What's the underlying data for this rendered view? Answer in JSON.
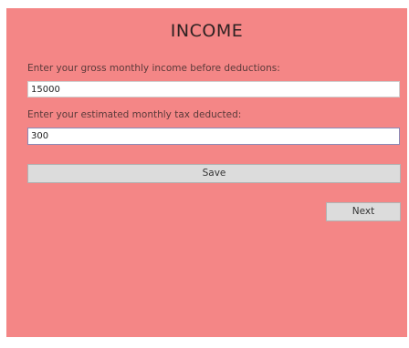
{
  "window": {
    "background": "#f48686"
  },
  "title": "INCOME",
  "form": {
    "gross_label": "Enter your gross monthly income before deductions:",
    "gross_value": "15000",
    "tax_label": "Enter your estimated monthly tax deducted:",
    "tax_value": "300"
  },
  "buttons": {
    "save_label": "Save",
    "next_label": "Next"
  }
}
